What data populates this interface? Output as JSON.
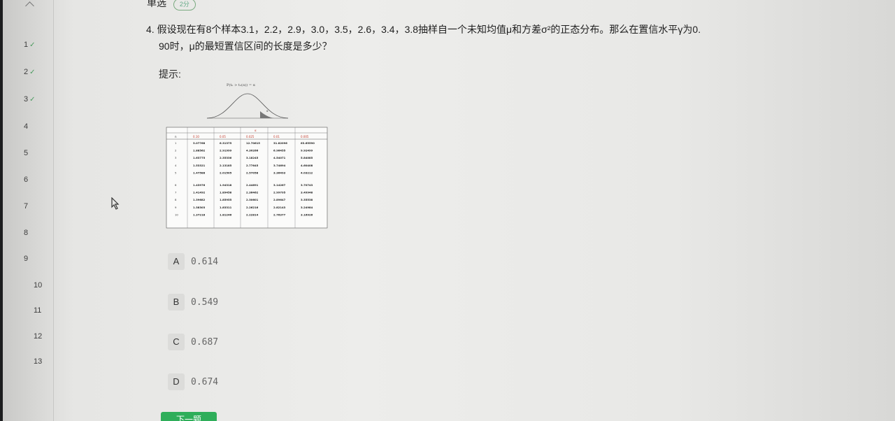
{
  "header": {
    "title": "单选",
    "badge": "2分"
  },
  "nav": {
    "items": [
      {
        "label": "1",
        "done": "✓"
      },
      {
        "label": "2",
        "done": "✓"
      },
      {
        "label": "3",
        "done": "✓"
      },
      {
        "label": "4",
        "done": ""
      },
      {
        "label": "5",
        "done": ""
      },
      {
        "label": "6",
        "done": ""
      },
      {
        "label": "7",
        "done": ""
      },
      {
        "label": "8",
        "done": ""
      },
      {
        "label": "9",
        "done": ""
      },
      {
        "label": "10",
        "done": ""
      },
      {
        "label": "11",
        "done": ""
      },
      {
        "label": "12",
        "done": ""
      },
      {
        "label": "13",
        "done": ""
      }
    ]
  },
  "question": {
    "line1": "4. 假设现在有8个样本3.1，2.2，2.9，3.0，3.5，2.6，3.4，3.8抽样自一个未知均值μ和方差σ²的正态分布。那么在置信水平γ为0.",
    "line2": "90时，μ的最短置信区间的长度是多少？",
    "hint_label": "提示:"
  },
  "hint_figure": {
    "formula": "P(tₙ > tₙ(α)) = α",
    "alpha_header": "α",
    "n_header": "n",
    "columns": [
      "0.10",
      "0.05",
      "0.025",
      "0.01",
      "0.005"
    ],
    "rows": [
      {
        "n": "1",
        "vals": [
          "3.07768",
          "6.31375",
          "12.70615",
          "31.82096",
          "63.65590"
        ]
      },
      {
        "n": "2",
        "vals": [
          "1.88562",
          "2.91999",
          "4.30266",
          "6.96455",
          "9.92499"
        ]
      },
      {
        "n": "3",
        "vals": [
          "1.63775",
          "2.35336",
          "3.18245",
          "4.54071",
          "5.84085"
        ]
      },
      {
        "n": "4",
        "vals": [
          "1.53321",
          "2.13185",
          "2.77645",
          "3.74694",
          "4.60408"
        ]
      },
      {
        "n": "5",
        "vals": [
          "1.47588",
          "2.01505",
          "2.57058",
          "3.36493",
          "4.03212"
        ]
      },
      {
        "n": "6",
        "vals": [
          "1.43976",
          "1.94318",
          "2.44691",
          "3.14267",
          "3.70743"
        ]
      },
      {
        "n": "7",
        "vals": [
          "1.41492",
          "1.89458",
          "2.36462",
          "2.99795",
          "3.49948"
        ]
      },
      {
        "n": "8",
        "vals": [
          "1.39682",
          "1.85955",
          "2.30601",
          "2.89647",
          "3.35538"
        ]
      },
      {
        "n": "9",
        "vals": [
          "1.38303",
          "1.83311",
          "2.26216",
          "2.82143",
          "3.24984"
        ]
      },
      {
        "n": "10",
        "vals": [
          "1.37218",
          "1.81246",
          "2.22814",
          "2.76377",
          "3.16926"
        ]
      }
    ]
  },
  "options": [
    {
      "letter": "A",
      "value": "0.614"
    },
    {
      "letter": "B",
      "value": "0.549"
    },
    {
      "letter": "C",
      "value": "0.687"
    },
    {
      "letter": "D",
      "value": "0.674"
    }
  ],
  "next_button": {
    "label": "下一题"
  },
  "colors": {
    "accent": "#2fae5a",
    "check": "#4a9b5e",
    "table_header": "#c0392b"
  }
}
